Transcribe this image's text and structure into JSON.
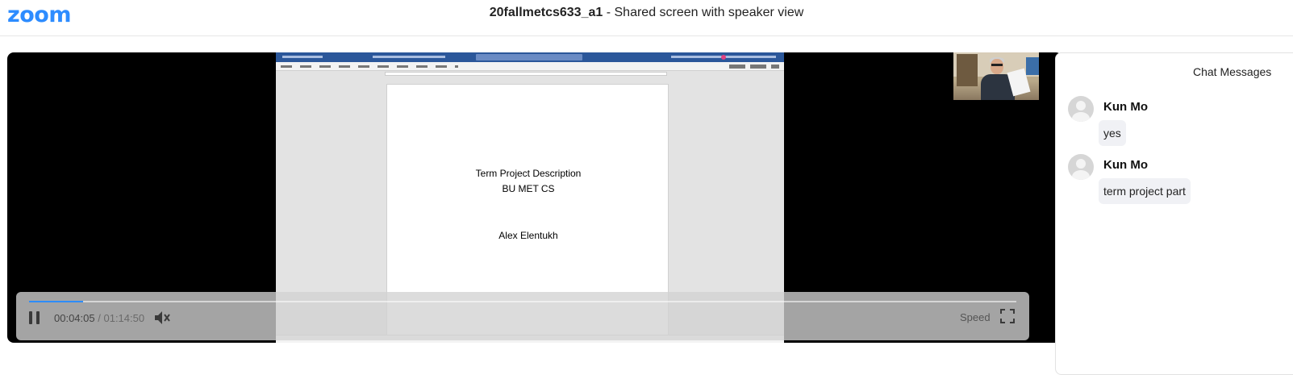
{
  "header": {
    "logo": "zoom",
    "recording_name": "20fallmetcs633_a1",
    "separator": " - ",
    "view_mode": "Shared screen with speaker view"
  },
  "shared_document": {
    "lines": [
      "Term Project Description",
      "BU MET CS",
      "Alex Elentukh"
    ]
  },
  "player": {
    "current_time": "00:04:05",
    "time_separator": "/",
    "duration": "01:14:50",
    "progress_fraction": 0.0546,
    "speed_label": "Speed"
  },
  "chat": {
    "title": "Chat Messages",
    "messages": [
      {
        "author": "Kun Mo",
        "text": "yes"
      },
      {
        "author": "Kun Mo",
        "text": "term project part"
      }
    ]
  },
  "colors": {
    "brand": "#2d8cff",
    "word_titlebar": "#2b579a"
  }
}
